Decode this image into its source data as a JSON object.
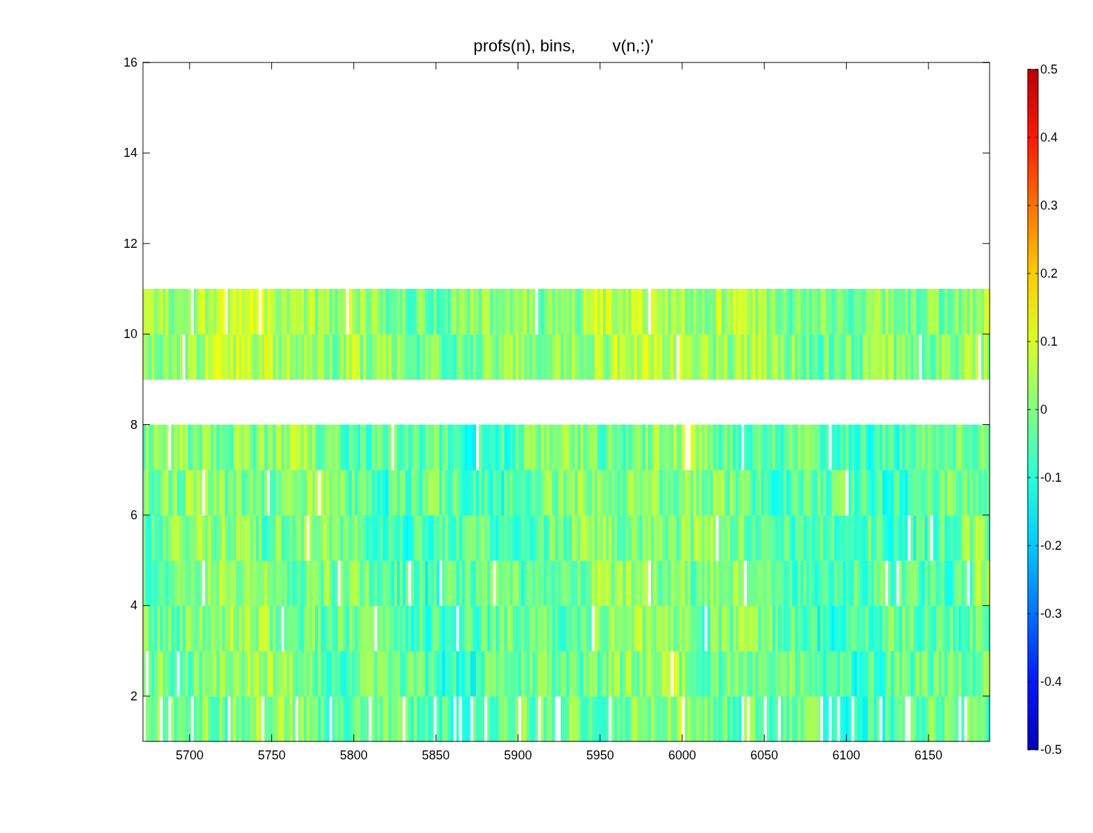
{
  "title": "profs(n), bins,        v(n,:)'",
  "x_ticks": [
    "5700",
    "5750",
    "5800",
    "5850",
    "5900",
    "5950",
    "6000",
    "6050",
    "6100",
    "6150"
  ],
  "y_ticks": [
    "16",
    "14",
    "12",
    "10",
    "8",
    "6",
    "4",
    "2"
  ],
  "colorbar_ticks": [
    "0.5",
    "0.4",
    "0.3",
    "0.2",
    "0.1",
    "0",
    "-0.1",
    "-0.2",
    "-0.3",
    "-0.4",
    "-0.5"
  ]
}
